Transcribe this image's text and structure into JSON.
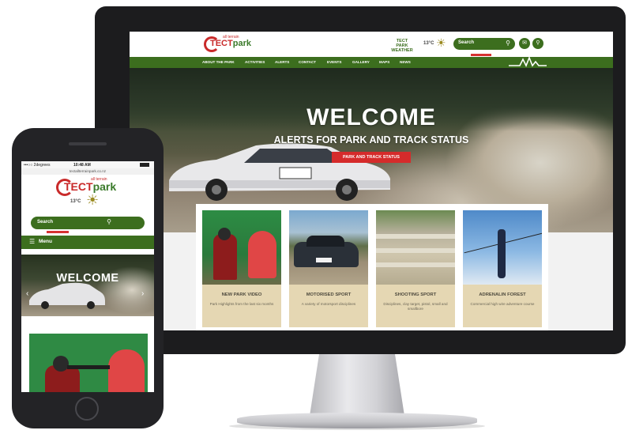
{
  "desktop": {
    "logo": {
      "small_text": "all terrain",
      "brand_left": "TECT",
      "brand_right": "park"
    },
    "weather": {
      "label": "TECT PARK WEATHER",
      "temperature": "13°C",
      "icon": "sun-icon"
    },
    "search": {
      "placeholder": "Search",
      "icon": "magnifier-icon"
    },
    "header_icons": [
      "email-icon",
      "location-icon"
    ],
    "nav": [
      "ABOUT THE PARK",
      "ACTIVITIES",
      "ALERTS",
      "CONTACT",
      "EVENTS",
      "GALLERY",
      "MAPS",
      "NEWS"
    ],
    "hero": {
      "title": "WELCOME",
      "subtitle": "ALERTS FOR PARK AND TRACK STATUS",
      "button": "PARK AND TRACK STATUS",
      "slide_count": 2,
      "active_slide": 1
    },
    "cards": [
      {
        "title": "NEW PARK VIDEO",
        "desc": "Park Highlights from the last six months"
      },
      {
        "title": "MOTORISED SPORT",
        "desc": "A variety of motorsport disciplines"
      },
      {
        "title": "SHOOTING SPORT",
        "desc": "Disciplines, clay target, pistol, small and smallbore"
      },
      {
        "title": "ADRENALIN FOREST",
        "desc": "Commercial high wire adventure course"
      }
    ]
  },
  "phone": {
    "status": {
      "carrier": "•••○○ 2degrees",
      "time": "10:48 AM"
    },
    "url": "tectallterrainpark.co.nz",
    "logo": {
      "small_text": "all terrain",
      "brand_left": "TECT",
      "brand_right": "park"
    },
    "weather": {
      "temperature": "13°C",
      "icon": "sun-icon"
    },
    "search": {
      "placeholder": "Search",
      "icon": "magnifier-icon"
    },
    "menu": {
      "label": "Menu",
      "icon": "hamburger-icon"
    },
    "hero": {
      "title": "WELCOME"
    }
  },
  "colors": {
    "brand_green": "#3c6e1e",
    "brand_red": "#d52b2b",
    "card_tan": "#e5d7b3"
  }
}
